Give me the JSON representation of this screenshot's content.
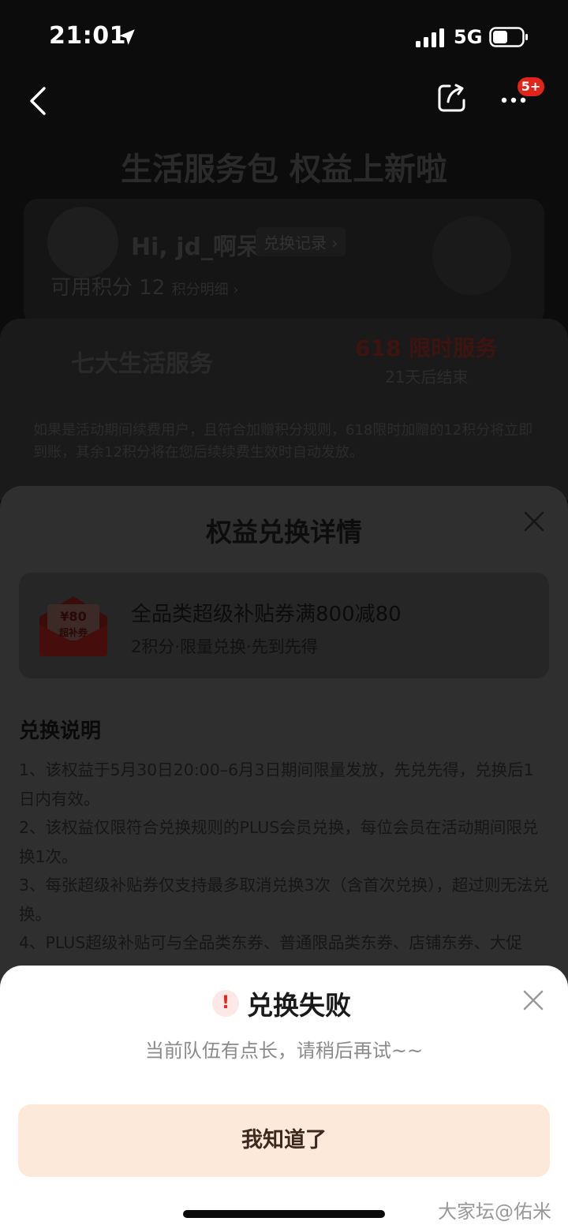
{
  "status_bar": {
    "time": "21:01",
    "network": "5G"
  },
  "nav": {
    "badge": "5+"
  },
  "background": {
    "banner_title": "生活服务包  权益上新啦",
    "greeting": "Hi, jd_啊呆",
    "record_link": "兑换记录 ›",
    "points_label": "可用积分 12",
    "points_detail": "积分明细 ›",
    "tab_services": "七大生活服务",
    "promo_title": "618 限时服务",
    "promo_countdown": "21天后结束",
    "promo_desc": "如果是活动期间续费用户，且符合加赠积分规则，618限时加赠的12积分将立即到账，其余12积分将在您后续续费生效时自动发放。"
  },
  "detail_sheet": {
    "title": "权益兑换详情",
    "coupon": {
      "badge_amount": "¥80",
      "badge_label": "超补券",
      "name": "全品类超级补贴券满800减80",
      "meta": "2积分·限量兑换·先到先得"
    },
    "rules_title": "兑换说明",
    "rules": [
      "1、该权益于5月30日20:00–6月3日期间限量发放，先兑先得，兑换后1日内有效。",
      "2、该权益仅限符合兑换规则的PLUS会员兑换，每位会员在活动期间限兑换1次。",
      "3、每张超级补贴券仅支持最多取消兑换3次（含首次兑换），超过则无法兑换。",
      "4、PLUS超级补贴可与全品类东券、普通限品类东券、店铺东券、大促"
    ]
  },
  "dialog": {
    "title": "兑换失败",
    "message": "当前队伍有点长，请稍后再试~~",
    "confirm_label": "我知道了",
    "watermark": "大家坛@佑米"
  }
}
